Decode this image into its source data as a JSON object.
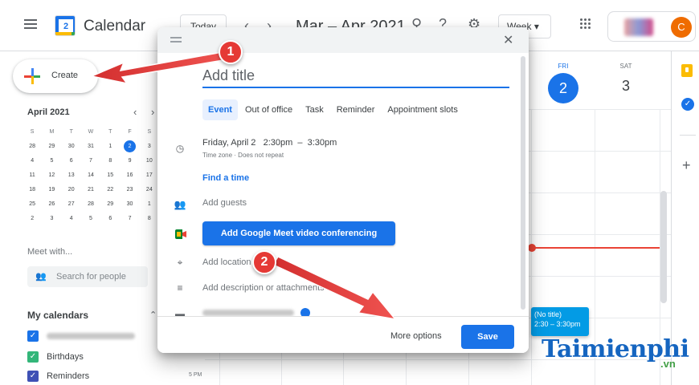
{
  "header": {
    "app_title": "Calendar",
    "logo_number": "2",
    "today_label": "Today",
    "prev_icon": "chevron-left-icon",
    "next_icon": "chevron-right-icon",
    "date_range": "Mar – Apr 2021",
    "view_label": "Week",
    "avatar_letter": "C"
  },
  "sidebar": {
    "create_label": "Create",
    "mini_calendar": {
      "month_label": "April 2021",
      "weekday_headers": [
        "S",
        "M",
        "T",
        "W",
        "T",
        "F",
        "S"
      ],
      "weeks": [
        [
          "28",
          "29",
          "30",
          "31",
          "1",
          "2",
          "3"
        ],
        [
          "4",
          "5",
          "6",
          "7",
          "8",
          "9",
          "10"
        ],
        [
          "11",
          "12",
          "13",
          "14",
          "15",
          "16",
          "17"
        ],
        [
          "18",
          "19",
          "20",
          "21",
          "22",
          "23",
          "24"
        ],
        [
          "25",
          "26",
          "27",
          "28",
          "29",
          "30",
          "1"
        ],
        [
          "2",
          "3",
          "4",
          "5",
          "6",
          "7",
          "8"
        ]
      ],
      "today": "2"
    },
    "meet_with_label": "Meet with...",
    "search_people_placeholder": "Search for people",
    "my_calendars_label": "My calendars",
    "calendars": [
      {
        "label": "",
        "color": "#1a73e8"
      },
      {
        "label": "Birthdays",
        "color": "#33b679"
      },
      {
        "label": "Reminders",
        "color": "#3f51b5"
      }
    ]
  },
  "week": {
    "days": [
      {
        "name": "FRI",
        "number": "2",
        "active": true
      },
      {
        "name": "SAT",
        "number": "3",
        "active": false
      }
    ],
    "time_label": "5 PM",
    "event": {
      "title": "(No title)",
      "time": "2:30 – 3:30pm"
    }
  },
  "dialog": {
    "title_placeholder": "Add title",
    "tabs": [
      {
        "label": "Event",
        "active": true
      },
      {
        "label": "Out of office",
        "active": false
      },
      {
        "label": "Task",
        "active": false
      },
      {
        "label": "Reminder",
        "active": false
      },
      {
        "label": "Appointment slots",
        "active": false
      }
    ],
    "date_line": "Friday, April 2   2:30pm  –  3:30pm",
    "timezone_line": "Time zone · Does not repeat",
    "find_time": "Find a time",
    "add_guests": "Add guests",
    "meet_button": "Add Google Meet video conferencing",
    "add_location": "Add location",
    "add_description": "Add description or attachments",
    "more_options": "More options",
    "save": "Save"
  },
  "annotations": {
    "step1": "1",
    "step2": "2",
    "arrow_color": "#e53935"
  },
  "watermark": {
    "brand": "Taimienphi",
    "tld": ".vn"
  }
}
